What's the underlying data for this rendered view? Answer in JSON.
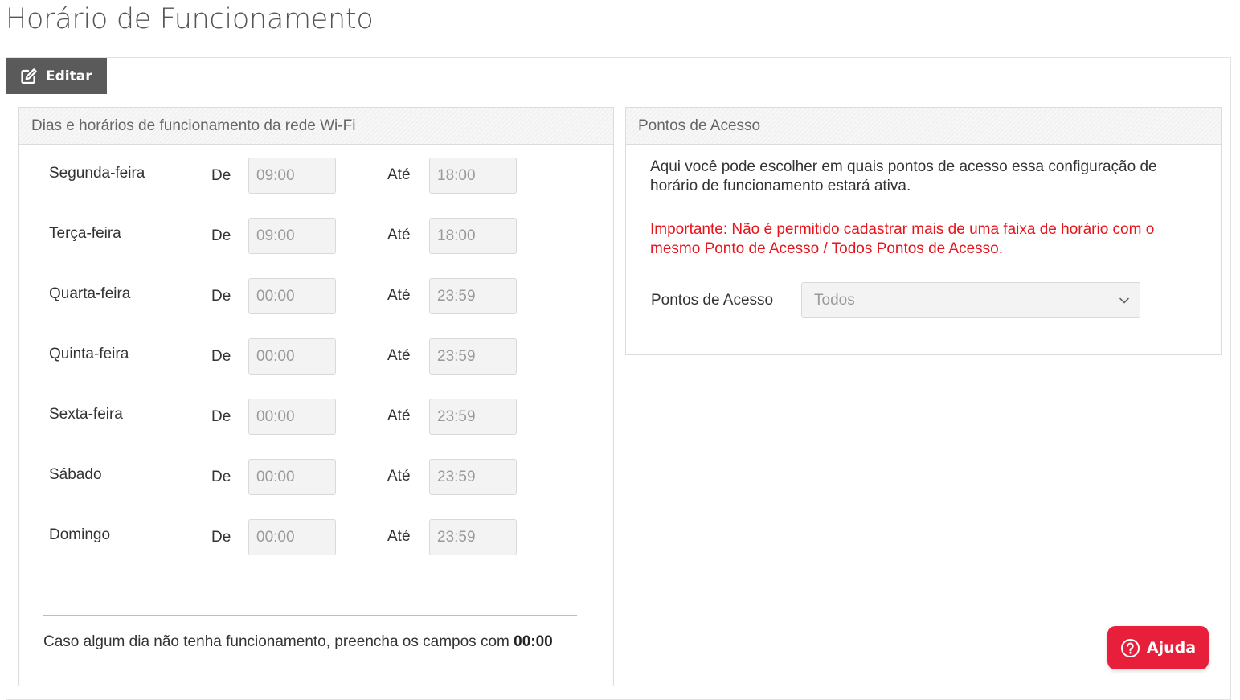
{
  "page": {
    "title": "Horário de Funcionamento"
  },
  "toolbar": {
    "edit_label": "Editar"
  },
  "schedule_panel": {
    "heading": "Dias e horários de funcionamento da rede Wi-Fi",
    "from_label": "De",
    "to_label": "Até",
    "days": [
      {
        "day": "Segunda-feira",
        "from": "09:00",
        "to": "18:00"
      },
      {
        "day": "Terça-feira",
        "from": "09:00",
        "to": "18:00"
      },
      {
        "day": "Quarta-feira",
        "from": "00:00",
        "to": "23:59"
      },
      {
        "day": "Quinta-feira",
        "from": "00:00",
        "to": "23:59"
      },
      {
        "day": "Sexta-feira",
        "from": "00:00",
        "to": "23:59"
      },
      {
        "day": "Sábado",
        "from": "00:00",
        "to": "23:59"
      },
      {
        "day": "Domingo",
        "from": "00:00",
        "to": "23:59"
      }
    ],
    "note_text": "Caso algum dia não tenha funcionamento, preencha os campos com ",
    "note_value": "00:00"
  },
  "access_points_panel": {
    "heading": "Pontos de Acesso",
    "description": "Aqui você pode escolher em quais pontos de acesso essa configuração de horário de funcionamento estará ativa.",
    "warning": "Importante: Não é permitido cadastrar mais de uma faixa de horário com o mesmo Ponto de Acesso / Todos Pontos de Acesso.",
    "select_label": "Pontos de Acesso",
    "select_value": "Todos"
  },
  "help_button": {
    "label": "Ajuda"
  },
  "colors": {
    "warning": "#e8141b",
    "help_button": "#e81f3a",
    "edit_tab": "#5a5a5a"
  }
}
